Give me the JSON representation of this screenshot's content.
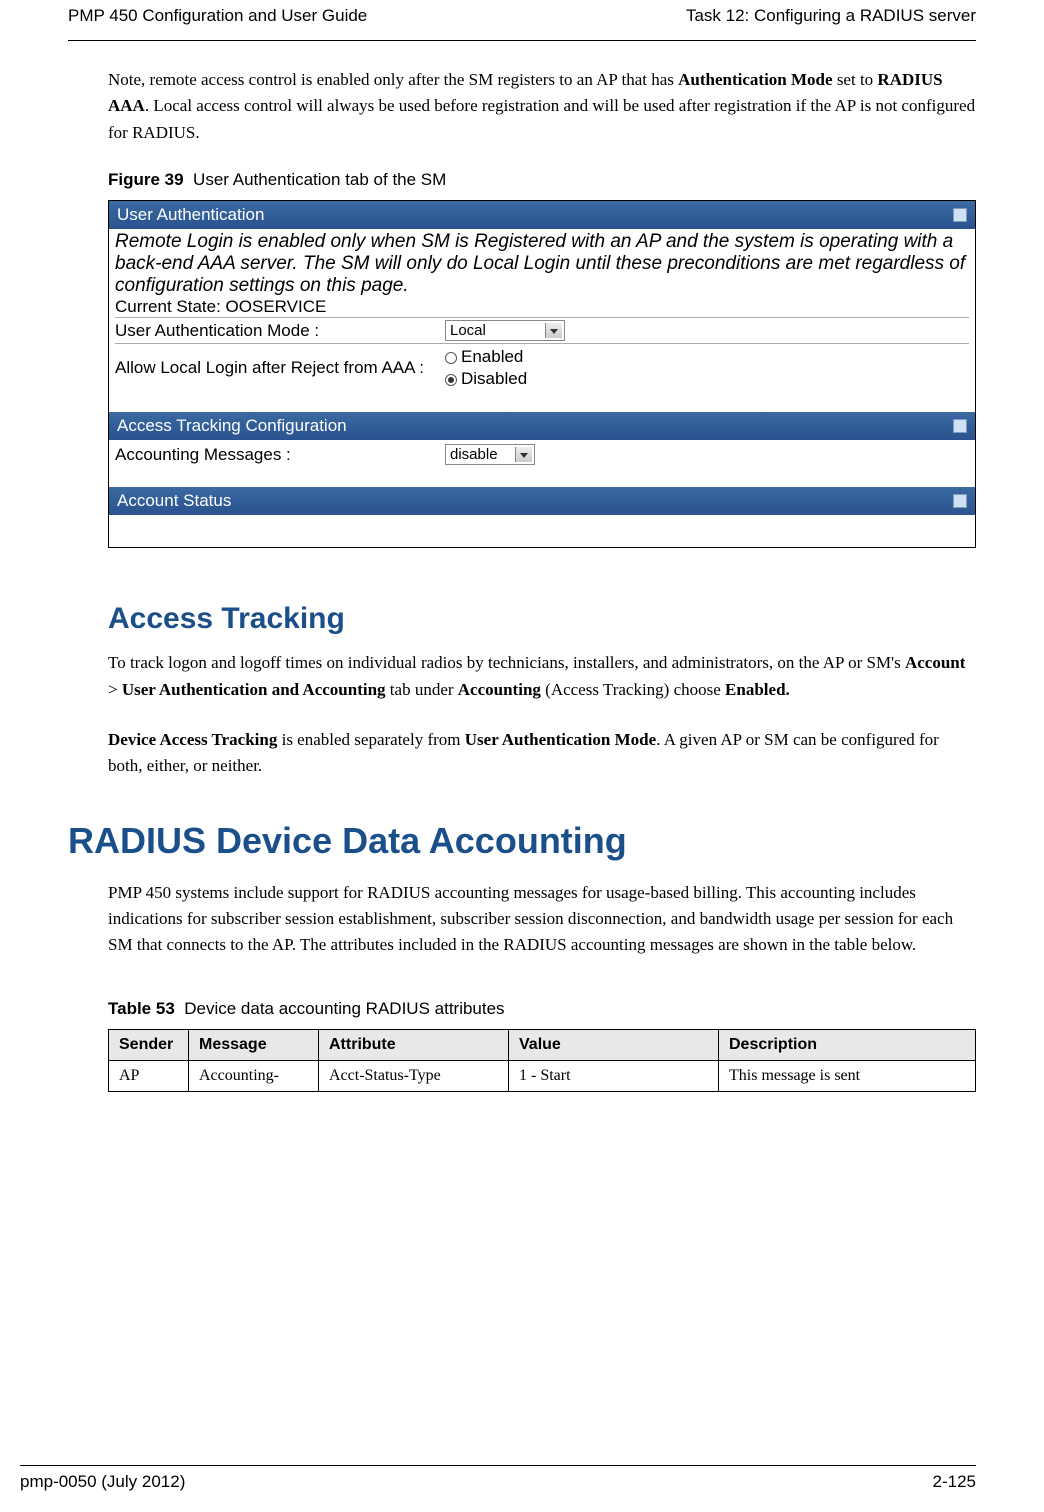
{
  "header": {
    "left": "PMP 450 Configuration and User Guide",
    "right": "Task 12: Configuring a RADIUS server"
  },
  "intro_paragraph": {
    "pre": "Note, remote access control is enabled only after the SM registers to an AP that has ",
    "bold1": "Authentication Mode",
    "mid1": " set to ",
    "bold2": "RADIUS AAA",
    "post": ". Local access control will always be used before registration and will be used after registration if the AP is not configured for RADIUS."
  },
  "figure": {
    "label": "Figure 39",
    "caption": "User Authentication tab of the SM"
  },
  "ui": {
    "panel1": {
      "title": "User Authentication",
      "note": "Remote Login is enabled only when SM is Registered with an AP and the system is operating with a back-end AAA server. The SM will only do Local Login until these preconditions are met regardless of configuration settings on this page.",
      "state_line": "Current State: OOSERVICE",
      "row1_label": "User Authentication Mode :",
      "row1_value": "Local",
      "row2_label": "Allow Local Login after Reject from AAA :",
      "row2_opt1": "Enabled",
      "row2_opt2": "Disabled"
    },
    "panel2": {
      "title": "Access Tracking Configuration",
      "row1_label": "Accounting Messages :",
      "row1_value": "disable"
    },
    "panel3": {
      "title": "Account Status"
    }
  },
  "section_access": {
    "title": "Access Tracking",
    "p1": {
      "t1": "To track logon and logoff times on individual radios by technicians, installers, and administrators, on the AP or SM's ",
      "b1": "Account",
      "t2": " > ",
      "b2": "User Authentication and Accounting",
      "t3": " tab under ",
      "b3": "Accounting",
      "t4": " (Access Tracking) choose ",
      "b4": "Enabled."
    },
    "p2": {
      "b1": "Device Access Tracking",
      "t1": " is enabled separately from ",
      "b2": "User Authentication Mode",
      "t2": ". A given AP or SM can be configured for both, either, or neither."
    }
  },
  "section_radius": {
    "title": "RADIUS Device Data Accounting",
    "p1": "PMP 450 systems include support for RADIUS accounting messages for usage-based billing.  This accounting includes indications for subscriber session establishment, subscriber session disconnection, and bandwidth usage per session for each SM that connects to the AP.  The attributes included in the RADIUS accounting messages are shown in the table below."
  },
  "table": {
    "label": "Table 53",
    "caption": "Device data accounting RADIUS attributes",
    "headers": [
      "Sender",
      "Message",
      "Attribute",
      "Value",
      "Description"
    ],
    "row1": [
      "AP",
      "Accounting-",
      "Acct-Status-Type",
      "1 - Start",
      "This message is sent"
    ]
  },
  "footer": {
    "left": "pmp-0050 (July 2012)",
    "right": "2-125"
  }
}
